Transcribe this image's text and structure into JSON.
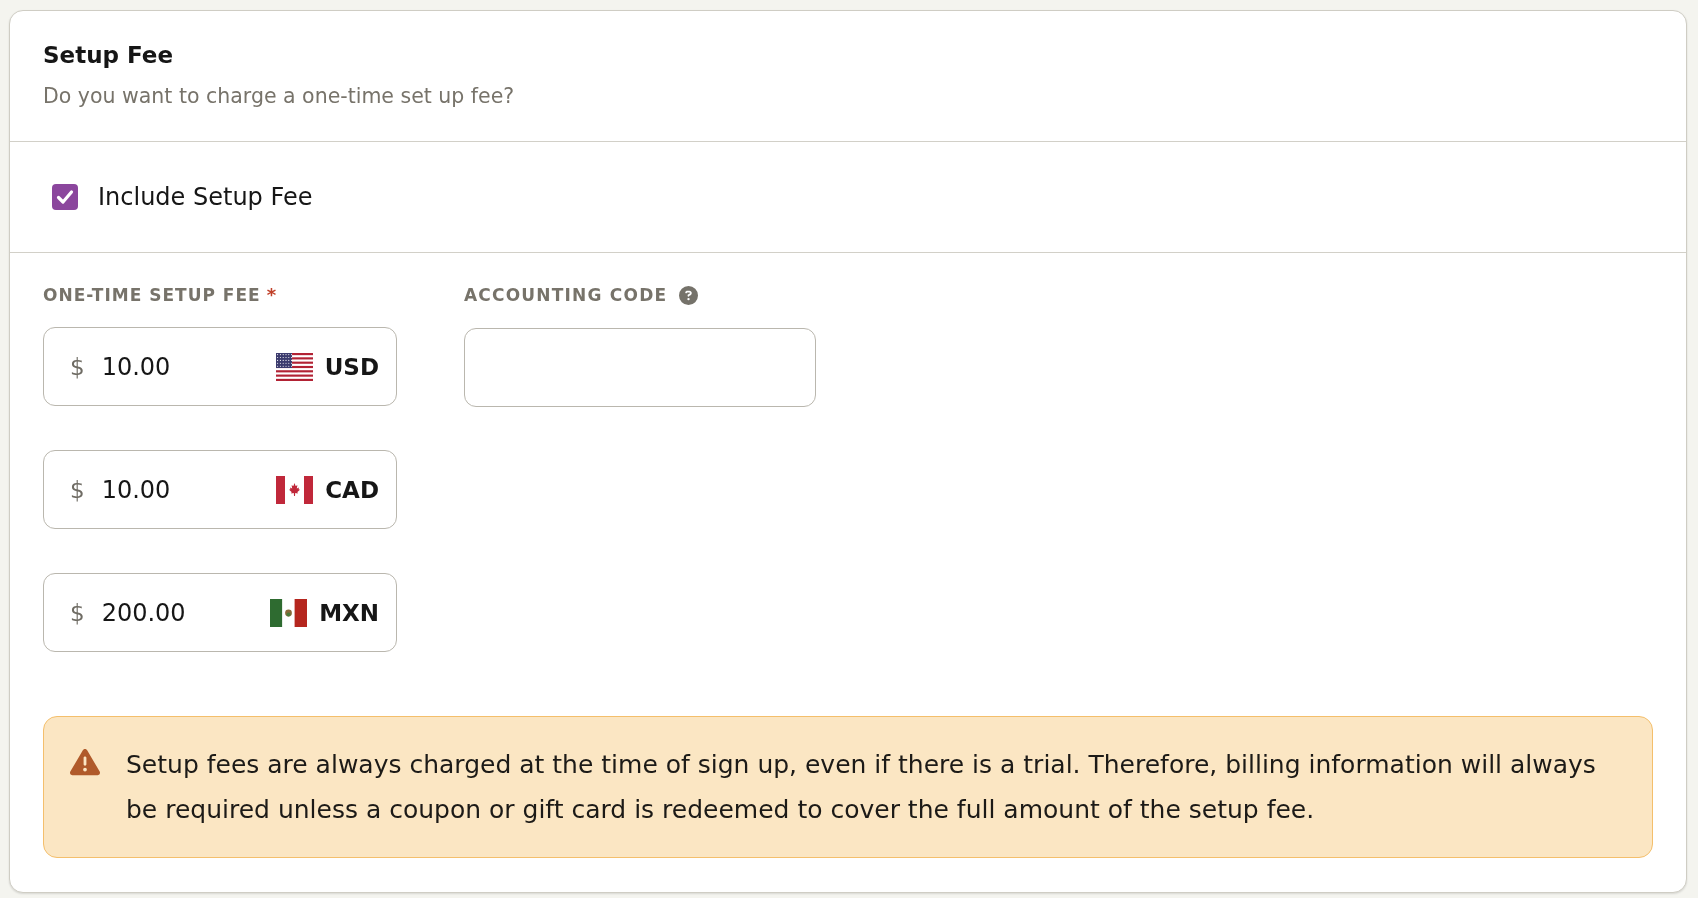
{
  "section": {
    "title": "Setup Fee",
    "subtitle": "Do you want to charge a one-time set up fee?"
  },
  "include_option": {
    "label": "Include Setup Fee",
    "checked": true
  },
  "fee_field": {
    "label": "ONE-TIME SETUP FEE",
    "required_mark": "*",
    "prices": [
      {
        "symbol": "$",
        "value": "10.00",
        "kind": "us",
        "currency": "USD"
      },
      {
        "symbol": "$",
        "value": "10.00",
        "kind": "ca",
        "currency": "CAD"
      },
      {
        "symbol": "$",
        "value": "200.00",
        "kind": "mx",
        "currency": "MXN"
      }
    ]
  },
  "accounting_code_field": {
    "label": "ACCOUNTING CODE"
  },
  "notice": {
    "text": "Setup fees are always charged at the time of sign up, even if there is a trial. Therefore, billing information will always be required unless a coupon or gift card is redeemed to cover the full amount of the setup fee."
  }
}
